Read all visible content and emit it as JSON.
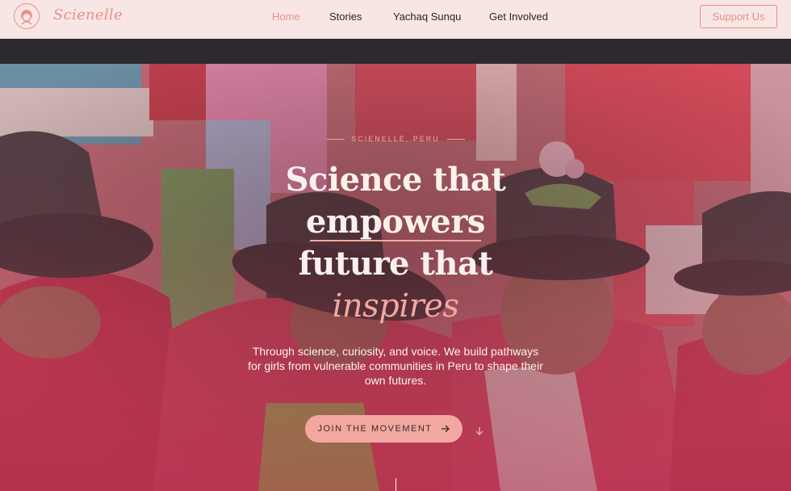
{
  "brand": {
    "name": "Scienelle",
    "logo_icon": "girl-portrait-icon"
  },
  "nav": {
    "items": [
      {
        "label": "Home",
        "active": true
      },
      {
        "label": "Stories",
        "active": false
      },
      {
        "label": "Yachaq Sunqu",
        "active": false
      },
      {
        "label": "Get Involved",
        "active": false
      }
    ],
    "support_label": "Support Us"
  },
  "hero": {
    "eyebrow": "SCIENELLE, PERU",
    "headline": [
      "Science that",
      "empowers",
      "future that"
    ],
    "headline_accent": "inspires",
    "description": "Through science, curiosity, and voice. We build pathways for girls from vulnerable communities in Peru to shape their own futures.",
    "cta_label": "JOIN THE MOVEMENT",
    "cta_icon": "arrow-right-icon",
    "scroll_icon": "arrow-down-icon"
  },
  "colors": {
    "accent": "#e8908a",
    "accent_light": "#f2a8a0",
    "nav_bg": "#f8e6e4",
    "dark": "#2c2a30"
  }
}
